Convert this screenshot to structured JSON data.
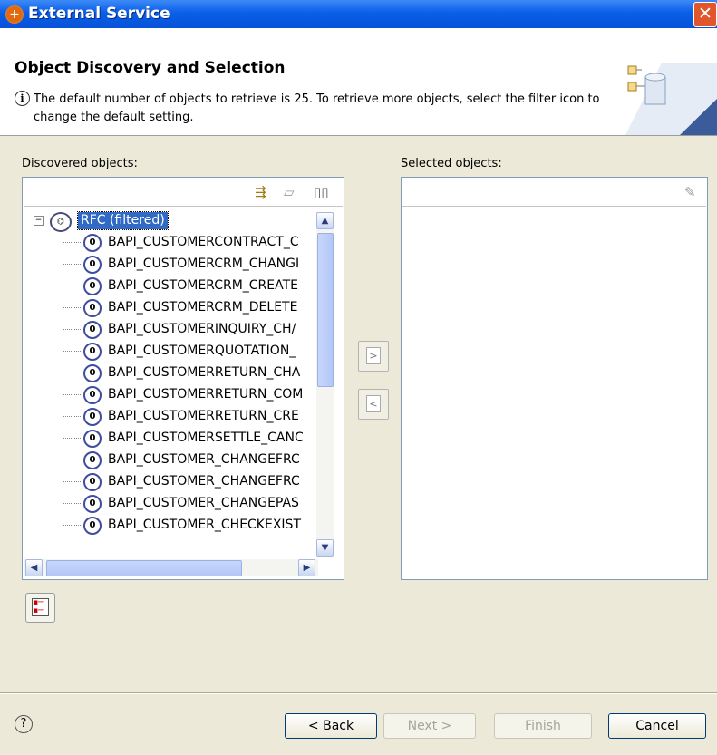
{
  "window": {
    "title": "External Service",
    "close_glyph": "✕"
  },
  "banner": {
    "heading": "Object Discovery and Selection",
    "message": "The default number of objects to retrieve is 25.  To retrieve more objects, select the filter icon to change the default setting."
  },
  "discovered": {
    "label": "Discovered objects:",
    "toolbar_icons": [
      "filter-icon",
      "clear-icon",
      "book-icon"
    ],
    "root": {
      "label": "RFC (filtered)",
      "expander": "−",
      "icon": "rfc-icon"
    },
    "items": [
      "BAPI_CUSTOMERCONTRACT_C",
      "BAPI_CUSTOMERCRM_CHANGI",
      "BAPI_CUSTOMERCRM_CREATE",
      "BAPI_CUSTOMERCRM_DELETE",
      "BAPI_CUSTOMERINQUIRY_CH/",
      "BAPI_CUSTOMERQUOTATION_",
      "BAPI_CUSTOMERRETURN_CHA",
      "BAPI_CUSTOMERRETURN_COM",
      "BAPI_CUSTOMERRETURN_CRE",
      "BAPI_CUSTOMERSETTLE_CANC",
      "BAPI_CUSTOMER_CHANGEFRC",
      "BAPI_CUSTOMER_CHANGEFRC",
      "BAPI_CUSTOMER_CHANGEPAS",
      "BAPI_CUSTOMER_CHECKEXIST"
    ],
    "item_icon_glyph": "0"
  },
  "selected": {
    "label": "Selected objects:"
  },
  "middle_buttons": {
    "add": ">",
    "remove": "<"
  },
  "footer": {
    "help_glyph": "?",
    "back": "< Back",
    "next": "Next >",
    "finish": "Finish",
    "cancel": "Cancel"
  }
}
